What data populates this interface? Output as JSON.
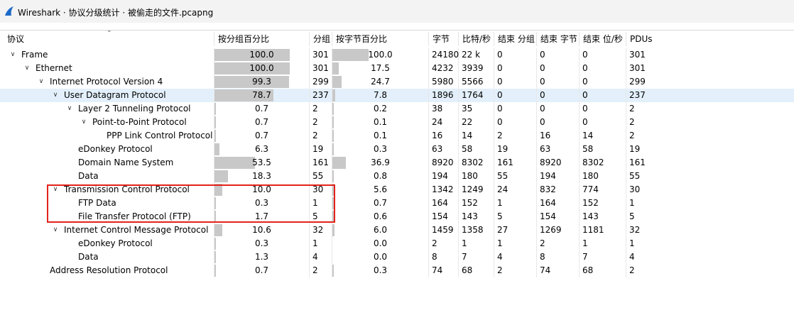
{
  "window": {
    "title": "Wireshark · 协议分级统计 · 被偷走的文件.pcapng",
    "icon": "wireshark-fin-icon"
  },
  "columns": [
    "协议",
    "按分组百分比",
    "分组",
    "按字节百分比",
    "字节",
    "比特/秒",
    "结束 分组",
    "结束 字节",
    "结束 位/秒",
    "PDUs"
  ],
  "rows": [
    {
      "depth": 0,
      "expander": "down",
      "name": "Frame",
      "pct_packets": "100.0",
      "packets": "301",
      "pct_bytes": "100.0",
      "bytes": "24180",
      "bps": "22 k",
      "end_packets": "0",
      "end_bytes": "0",
      "end_bps": "0",
      "pdus": "301",
      "fill_packets": 100.0,
      "fill_bytes": 100.0
    },
    {
      "depth": 1,
      "expander": "down",
      "name": "Ethernet",
      "pct_packets": "100.0",
      "packets": "301",
      "pct_bytes": "17.5",
      "bytes": "4232",
      "bps": "3939",
      "end_packets": "0",
      "end_bytes": "0",
      "end_bps": "0",
      "pdus": "301",
      "fill_packets": 100.0,
      "fill_bytes": 17.5
    },
    {
      "depth": 2,
      "expander": "down",
      "name": "Internet Protocol Version 4",
      "pct_packets": "99.3",
      "packets": "299",
      "pct_bytes": "24.7",
      "bytes": "5980",
      "bps": "5566",
      "end_packets": "0",
      "end_bytes": "0",
      "end_bps": "0",
      "pdus": "299",
      "fill_packets": 99.3,
      "fill_bytes": 24.7
    },
    {
      "depth": 3,
      "expander": "down",
      "selected": true,
      "name": "User Datagram Protocol",
      "pct_packets": "78.7",
      "packets": "237",
      "pct_bytes": "7.8",
      "bytes": "1896",
      "bps": "1764",
      "end_packets": "0",
      "end_bytes": "0",
      "end_bps": "0",
      "pdus": "237",
      "fill_packets": 78.7,
      "fill_bytes": 7.8
    },
    {
      "depth": 4,
      "expander": "down",
      "name": "Layer 2 Tunneling Protocol",
      "pct_packets": "0.7",
      "packets": "2",
      "pct_bytes": "0.2",
      "bytes": "38",
      "bps": "35",
      "end_packets": "0",
      "end_bytes": "0",
      "end_bps": "0",
      "pdus": "2",
      "fill_packets": 0.7,
      "fill_bytes": 0.2
    },
    {
      "depth": 5,
      "expander": "down",
      "name": "Point-to-Point Protocol",
      "pct_packets": "0.7",
      "packets": "2",
      "pct_bytes": "0.1",
      "bytes": "24",
      "bps": "22",
      "end_packets": "0",
      "end_bytes": "0",
      "end_bps": "0",
      "pdus": "2",
      "fill_packets": 0.7,
      "fill_bytes": 0.1
    },
    {
      "depth": 6,
      "expander": "none",
      "name": "PPP Link Control Protocol",
      "pct_packets": "0.7",
      "packets": "2",
      "pct_bytes": "0.1",
      "bytes": "16",
      "bps": "14",
      "end_packets": "2",
      "end_bytes": "16",
      "end_bps": "14",
      "pdus": "2",
      "fill_packets": 0.7,
      "fill_bytes": 0.1
    },
    {
      "depth": 4,
      "expander": "none",
      "name": "eDonkey Protocol",
      "pct_packets": "6.3",
      "packets": "19",
      "pct_bytes": "0.3",
      "bytes": "63",
      "bps": "58",
      "end_packets": "19",
      "end_bytes": "63",
      "end_bps": "58",
      "pdus": "19",
      "fill_packets": 6.3,
      "fill_bytes": 0.3
    },
    {
      "depth": 4,
      "expander": "none",
      "name": "Domain Name System",
      "pct_packets": "53.5",
      "packets": "161",
      "pct_bytes": "36.9",
      "bytes": "8920",
      "bps": "8302",
      "end_packets": "161",
      "end_bytes": "8920",
      "end_bps": "8302",
      "pdus": "161",
      "fill_packets": 53.5,
      "fill_bytes": 36.9
    },
    {
      "depth": 4,
      "expander": "none",
      "name": "Data",
      "pct_packets": "18.3",
      "packets": "55",
      "pct_bytes": "0.8",
      "bytes": "194",
      "bps": "180",
      "end_packets": "55",
      "end_bytes": "194",
      "end_bps": "180",
      "pdus": "55",
      "fill_packets": 18.3,
      "fill_bytes": 0.8
    },
    {
      "depth": 3,
      "expander": "down",
      "name": "Transmission Control Protocol",
      "pct_packets": "10.0",
      "packets": "30",
      "pct_bytes": "5.6",
      "bytes": "1342",
      "bps": "1249",
      "end_packets": "24",
      "end_bytes": "832",
      "end_bps": "774",
      "pdus": "30",
      "fill_packets": 10.0,
      "fill_bytes": 5.6
    },
    {
      "depth": 4,
      "expander": "none",
      "name": "FTP Data",
      "pct_packets": "0.3",
      "packets": "1",
      "pct_bytes": "0.7",
      "bytes": "164",
      "bps": "152",
      "end_packets": "1",
      "end_bytes": "164",
      "end_bps": "152",
      "pdus": "1",
      "fill_packets": 0.3,
      "fill_bytes": 0.7
    },
    {
      "depth": 4,
      "expander": "none",
      "name": "File Transfer Protocol (FTP)",
      "pct_packets": "1.7",
      "packets": "5",
      "pct_bytes": "0.6",
      "bytes": "154",
      "bps": "143",
      "end_packets": "5",
      "end_bytes": "154",
      "end_bps": "143",
      "pdus": "5",
      "fill_packets": 1.7,
      "fill_bytes": 0.6
    },
    {
      "depth": 3,
      "expander": "down",
      "name": "Internet Control Message Protocol",
      "pct_packets": "10.6",
      "packets": "32",
      "pct_bytes": "6.0",
      "bytes": "1459",
      "bps": "1358",
      "end_packets": "27",
      "end_bytes": "1269",
      "end_bps": "1181",
      "pdus": "32",
      "fill_packets": 10.6,
      "fill_bytes": 6.0
    },
    {
      "depth": 4,
      "expander": "none",
      "name": "eDonkey Protocol",
      "pct_packets": "0.3",
      "packets": "1",
      "pct_bytes": "0.0",
      "bytes": "2",
      "bps": "1",
      "end_packets": "1",
      "end_bytes": "2",
      "end_bps": "1",
      "pdus": "1",
      "fill_packets": 0.3,
      "fill_bytes": 0.0
    },
    {
      "depth": 4,
      "expander": "none",
      "name": "Data",
      "pct_packets": "1.3",
      "packets": "4",
      "pct_bytes": "0.0",
      "bytes": "8",
      "bps": "7",
      "end_packets": "4",
      "end_bytes": "8",
      "end_bps": "7",
      "pdus": "4",
      "fill_packets": 1.3,
      "fill_bytes": 0.0
    },
    {
      "depth": 2,
      "expander": "none",
      "name": "Address Resolution Protocol",
      "pct_packets": "0.7",
      "packets": "2",
      "pct_bytes": "0.3",
      "bytes": "74",
      "bps": "68",
      "end_packets": "2",
      "end_bytes": "74",
      "end_bps": "68",
      "pdus": "2",
      "fill_packets": 0.7,
      "fill_bytes": 0.3
    }
  ],
  "colors": {
    "bar": "#c8c8c8",
    "selected_row": "#e3f0fb",
    "annotation_box": "#e2231a",
    "icon_blue": "#1b6ac9"
  }
}
